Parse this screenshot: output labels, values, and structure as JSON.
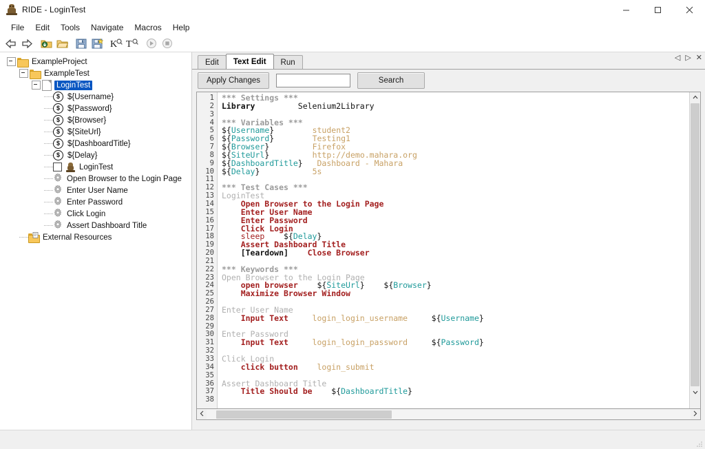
{
  "window": {
    "title": "RIDE - LoginTest",
    "app_icon": "robot-icon",
    "controls": {
      "minimize": "–",
      "maximize": "□",
      "close": "✕"
    }
  },
  "menubar": {
    "items": [
      "File",
      "Edit",
      "Tools",
      "Navigate",
      "Macros",
      "Help"
    ]
  },
  "toolbar": {
    "items": [
      {
        "name": "back-icon",
        "glyph": "⇦"
      },
      {
        "name": "forward-icon",
        "glyph": "⇨"
      },
      {
        "name": "open-project-icon",
        "glyph": "open-dir"
      },
      {
        "name": "open-directory-icon",
        "glyph": "dir"
      },
      {
        "name": "save-icon",
        "glyph": "floppy"
      },
      {
        "name": "save-all-icon",
        "glyph": "floppy-star"
      },
      {
        "name": "search-keyword-icon",
        "glyph": "K"
      },
      {
        "name": "search-tests-icon",
        "glyph": "T"
      },
      {
        "name": "run-icon",
        "glyph": "▶"
      },
      {
        "name": "stop-icon",
        "glyph": "■"
      }
    ]
  },
  "tree": {
    "nodes": [
      {
        "label": "ExampleProject",
        "icon": "folder-icon",
        "indent": 0,
        "expander": true,
        "selected": false
      },
      {
        "label": "ExampleTest",
        "icon": "folder-icon",
        "indent": 1,
        "expander": true,
        "selected": false
      },
      {
        "label": "LoginTest",
        "icon": "document-icon",
        "indent": 2,
        "expander": true,
        "selected": true
      },
      {
        "label": "${Username}",
        "icon": "variable-icon",
        "indent": 3,
        "expander": false,
        "selected": false
      },
      {
        "label": "${Password}",
        "icon": "variable-icon",
        "indent": 3,
        "expander": false,
        "selected": false
      },
      {
        "label": "${Browser}",
        "icon": "variable-icon",
        "indent": 3,
        "expander": false,
        "selected": false
      },
      {
        "label": "${SiteUrl}",
        "icon": "variable-icon",
        "indent": 3,
        "expander": false,
        "selected": false
      },
      {
        "label": "${DashboardTitle}",
        "icon": "variable-icon",
        "indent": 3,
        "expander": false,
        "selected": false
      },
      {
        "label": "${Delay}",
        "icon": "variable-icon",
        "indent": 3,
        "expander": false,
        "selected": false
      },
      {
        "label": "LoginTest",
        "icon": "testcase-icon",
        "indent": 3,
        "expander": false,
        "selected": false
      },
      {
        "label": "Open Browser to the Login Page",
        "icon": "keyword-gear-icon",
        "indent": 3,
        "expander": false,
        "selected": false
      },
      {
        "label": "Enter User Name",
        "icon": "keyword-gear-icon",
        "indent": 3,
        "expander": false,
        "selected": false
      },
      {
        "label": "Enter Password",
        "icon": "keyword-gear-icon",
        "indent": 3,
        "expander": false,
        "selected": false
      },
      {
        "label": "Click Login",
        "icon": "keyword-gear-icon",
        "indent": 3,
        "expander": false,
        "selected": false
      },
      {
        "label": "Assert Dashboard Title",
        "icon": "keyword-gear-icon",
        "indent": 3,
        "expander": false,
        "selected": false
      },
      {
        "label": "External Resources",
        "icon": "resource-folder-icon",
        "indent": 1,
        "expander": false,
        "selected": false
      }
    ]
  },
  "editor": {
    "tabs": [
      {
        "label": "Edit",
        "active": false
      },
      {
        "label": "Text Edit",
        "active": true
      },
      {
        "label": "Run",
        "active": false
      }
    ],
    "panel_buttons": [
      {
        "name": "prev-pane-icon",
        "glyph": "◁"
      },
      {
        "name": "next-pane-icon",
        "glyph": "▷"
      },
      {
        "name": "close-pane-icon",
        "glyph": "✕"
      }
    ],
    "apply_changes_label": "Apply Changes",
    "search_value": "",
    "search_placeholder": "",
    "search_button_label": "Search",
    "first_line_number": 1,
    "last_line_number": 38,
    "colors": {
      "section": "#9b9b9b",
      "setting": "#111111",
      "value": "#c8a165",
      "variable": "#1f9a9a",
      "keyword": "#a32020",
      "keyword_name": "#b0b0b0",
      "selection": "#0a57c2"
    },
    "code_lines": [
      {
        "n": 1,
        "tokens": [
          {
            "t": "*** Settings ***",
            "c": "c-sec"
          }
        ]
      },
      {
        "n": 2,
        "tokens": [
          {
            "t": "Library",
            "c": "c-set"
          },
          {
            "t": "         Selenium2Library",
            "c": "c-set-plain"
          }
        ]
      },
      {
        "n": 3,
        "tokens": []
      },
      {
        "n": 4,
        "tokens": [
          {
            "t": "*** Variables ***",
            "c": "c-sec"
          }
        ]
      },
      {
        "n": 5,
        "tokens": [
          {
            "t": "${",
            "c": "c-brace"
          },
          {
            "t": "Username",
            "c": "c-var"
          },
          {
            "t": "}",
            "c": "c-brace"
          },
          {
            "t": "        student2",
            "c": "c-val"
          }
        ]
      },
      {
        "n": 6,
        "tokens": [
          {
            "t": "${",
            "c": "c-brace"
          },
          {
            "t": "Password",
            "c": "c-var"
          },
          {
            "t": "}",
            "c": "c-brace"
          },
          {
            "t": "        Testing1",
            "c": "c-val"
          }
        ]
      },
      {
        "n": 7,
        "tokens": [
          {
            "t": "${",
            "c": "c-brace"
          },
          {
            "t": "Browser",
            "c": "c-var"
          },
          {
            "t": "}",
            "c": "c-brace"
          },
          {
            "t": "         Firefox",
            "c": "c-val"
          }
        ]
      },
      {
        "n": 8,
        "tokens": [
          {
            "t": "${",
            "c": "c-brace"
          },
          {
            "t": "SiteUrl",
            "c": "c-var"
          },
          {
            "t": "}",
            "c": "c-brace"
          },
          {
            "t": "         http://demo.mahara.org",
            "c": "c-val"
          }
        ]
      },
      {
        "n": 9,
        "tokens": [
          {
            "t": "${",
            "c": "c-brace"
          },
          {
            "t": "DashboardTitle",
            "c": "c-var"
          },
          {
            "t": "}",
            "c": "c-brace"
          },
          {
            "t": "   Dashboard - Mahara",
            "c": "c-val"
          }
        ]
      },
      {
        "n": 10,
        "tokens": [
          {
            "t": "${",
            "c": "c-brace"
          },
          {
            "t": "Delay",
            "c": "c-var"
          },
          {
            "t": "}",
            "c": "c-brace"
          },
          {
            "t": "           5s",
            "c": "c-val"
          }
        ]
      },
      {
        "n": 11,
        "tokens": []
      },
      {
        "n": 12,
        "tokens": [
          {
            "t": "*** Test Cases ***",
            "c": "c-sec"
          }
        ]
      },
      {
        "n": 13,
        "tokens": [
          {
            "t": "LoginTest",
            "c": "c-kwname"
          }
        ]
      },
      {
        "n": 14,
        "tokens": [
          {
            "t": "    Open Browser to the Login Page",
            "c": "c-kw"
          }
        ]
      },
      {
        "n": 15,
        "tokens": [
          {
            "t": "    Enter User Name",
            "c": "c-kw"
          }
        ]
      },
      {
        "n": 16,
        "tokens": [
          {
            "t": "    Enter Password",
            "c": "c-kw"
          }
        ]
      },
      {
        "n": 17,
        "tokens": [
          {
            "t": "    Click Login",
            "c": "c-kw"
          }
        ]
      },
      {
        "n": 18,
        "tokens": [
          {
            "t": "    sleep",
            "c": "c-kw-plain"
          },
          {
            "t": "    ${",
            "c": "c-brace"
          },
          {
            "t": "Delay",
            "c": "c-var"
          },
          {
            "t": "}",
            "c": "c-brace"
          }
        ]
      },
      {
        "n": 19,
        "tokens": [
          {
            "t": "    Assert Dashboard Title",
            "c": "c-kw"
          }
        ]
      },
      {
        "n": 20,
        "tokens": [
          {
            "t": "    [Teardown]",
            "c": "c-set"
          },
          {
            "t": "    Close Browser",
            "c": "c-kw"
          }
        ]
      },
      {
        "n": 21,
        "tokens": []
      },
      {
        "n": 22,
        "tokens": [
          {
            "t": "*** Keywords ***",
            "c": "c-sec"
          }
        ]
      },
      {
        "n": 23,
        "tokens": [
          {
            "t": "Open Browser to the Login Page",
            "c": "c-kwname"
          }
        ]
      },
      {
        "n": 24,
        "tokens": [
          {
            "t": "    open browser",
            "c": "c-kw"
          },
          {
            "t": "    ${",
            "c": "c-brace"
          },
          {
            "t": "SiteUrl",
            "c": "c-var"
          },
          {
            "t": "}",
            "c": "c-brace"
          },
          {
            "t": "    ${",
            "c": "c-brace"
          },
          {
            "t": "Browser",
            "c": "c-var"
          },
          {
            "t": "}",
            "c": "c-brace"
          }
        ]
      },
      {
        "n": 25,
        "tokens": [
          {
            "t": "    Maximize Browser Window",
            "c": "c-kw"
          }
        ]
      },
      {
        "n": 26,
        "tokens": []
      },
      {
        "n": 27,
        "tokens": [
          {
            "t": "Enter User Name",
            "c": "c-kwname"
          }
        ]
      },
      {
        "n": 28,
        "tokens": [
          {
            "t": "    Input Text",
            "c": "c-kw"
          },
          {
            "t": "     login_login_username",
            "c": "c-val"
          },
          {
            "t": "     ${",
            "c": "c-brace"
          },
          {
            "t": "Username",
            "c": "c-var"
          },
          {
            "t": "}",
            "c": "c-brace"
          }
        ]
      },
      {
        "n": 29,
        "tokens": []
      },
      {
        "n": 30,
        "tokens": [
          {
            "t": "Enter Password",
            "c": "c-kwname"
          }
        ]
      },
      {
        "n": 31,
        "tokens": [
          {
            "t": "    Input Text",
            "c": "c-kw"
          },
          {
            "t": "     login_login_password",
            "c": "c-val"
          },
          {
            "t": "     ${",
            "c": "c-brace"
          },
          {
            "t": "Password",
            "c": "c-var"
          },
          {
            "t": "}",
            "c": "c-brace"
          }
        ]
      },
      {
        "n": 32,
        "tokens": []
      },
      {
        "n": 33,
        "tokens": [
          {
            "t": "Click Login",
            "c": "c-kwname"
          }
        ]
      },
      {
        "n": 34,
        "tokens": [
          {
            "t": "    click button",
            "c": "c-kw"
          },
          {
            "t": "    login_submit",
            "c": "c-val"
          }
        ]
      },
      {
        "n": 35,
        "tokens": []
      },
      {
        "n": 36,
        "tokens": [
          {
            "t": "Assert Dashboard Title",
            "c": "c-kwname"
          }
        ]
      },
      {
        "n": 37,
        "tokens": [
          {
            "t": "    Title Should be",
            "c": "c-kw"
          },
          {
            "t": "    ${",
            "c": "c-brace"
          },
          {
            "t": "DashboardTitle",
            "c": "c-var"
          },
          {
            "t": "}",
            "c": "c-brace"
          }
        ]
      },
      {
        "n": 38,
        "tokens": []
      }
    ]
  },
  "statusbar": {
    "text": ""
  }
}
